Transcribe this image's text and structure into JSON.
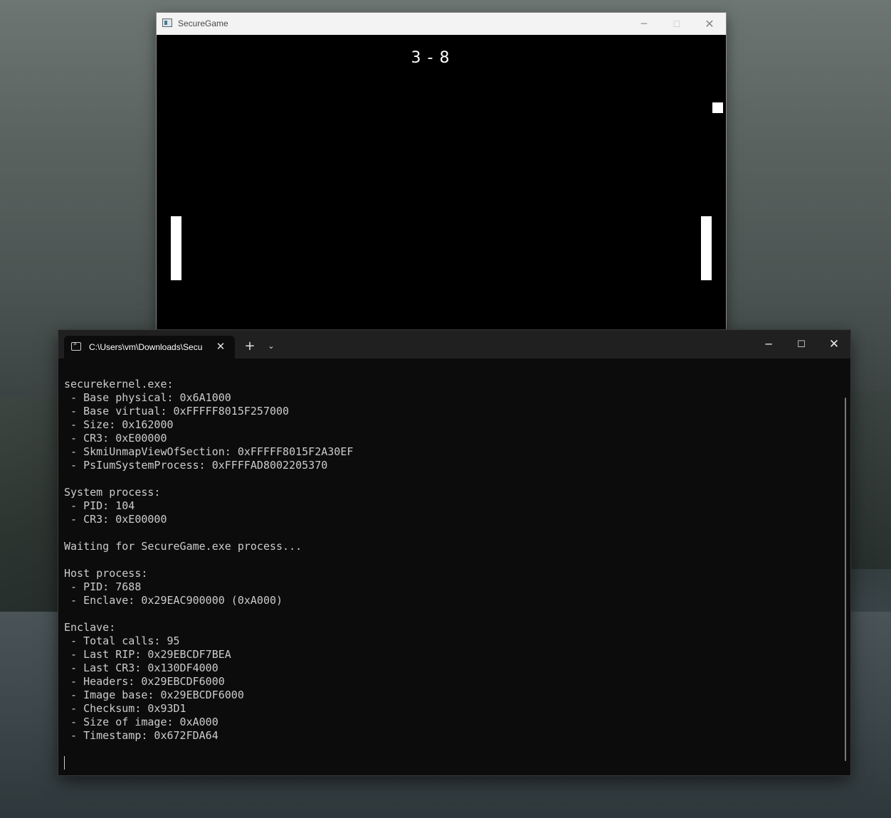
{
  "game": {
    "title": "SecureGame",
    "score": "3 - 8"
  },
  "terminal": {
    "tab_title": "C:\\Users\\vm\\Downloads\\Secu",
    "lines": [
      "securekernel.exe:",
      " - Base physical: 0x6A1000",
      " - Base virtual: 0xFFFFF8015F257000",
      " - Size: 0x162000",
      " - CR3: 0xE00000",
      " - SkmiUnmapViewOfSection: 0xFFFFF8015F2A30EF",
      " - PsIumSystemProcess: 0xFFFFAD8002205370",
      "",
      "System process:",
      " - PID: 104",
      " - CR3: 0xE00000",
      "",
      "Waiting for SecureGame.exe process...",
      "",
      "Host process:",
      " - PID: 7688",
      " - Enclave: 0x29EAC900000 (0xA000)",
      "",
      "Enclave:",
      " - Total calls: 95",
      " - Last RIP: 0x29EBCDF7BEA",
      " - Last CR3: 0x130DF4000",
      " - Headers: 0x29EBCDF6000",
      " - Image base: 0x29EBCDF6000",
      " - Checksum: 0x93D1",
      " - Size of image: 0xA000",
      " - Timestamp: 0x672FDA64"
    ]
  }
}
